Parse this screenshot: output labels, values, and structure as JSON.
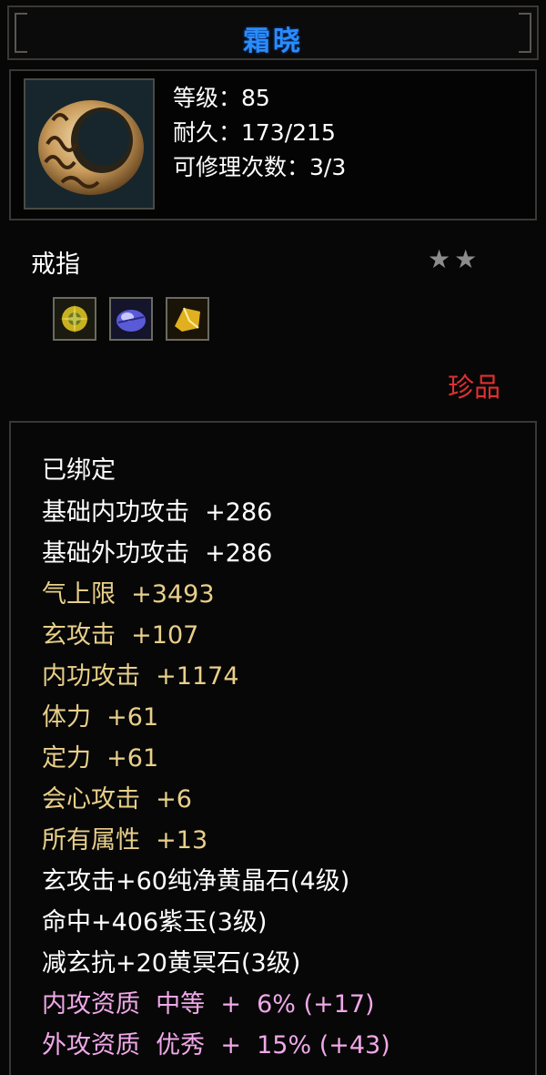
{
  "title": "霜晓",
  "item": {
    "icon": "ring-icon",
    "level": "等级：85",
    "durability": "耐久：173/215",
    "repairs": "可修理次数：3/3",
    "type": "戒指",
    "stars": 2,
    "rarity": "珍品",
    "rarity_color": "#e03030",
    "gems": [
      "yellow-crystal-gem-icon",
      "purple-jade-gem-icon",
      "yellow-stone-gem-icon"
    ]
  },
  "attributes": [
    {
      "text": "已绑定",
      "color": "white"
    },
    {
      "text": "基础内功攻击  +286",
      "color": "white"
    },
    {
      "text": "基础外功攻击  +286",
      "color": "white"
    },
    {
      "text": "气上限  +3493",
      "color": "gold"
    },
    {
      "text": "玄攻击  +107",
      "color": "gold"
    },
    {
      "text": "内功攻击  +1174",
      "color": "gold"
    },
    {
      "text": "体力  +61",
      "color": "gold"
    },
    {
      "text": "定力  +61",
      "color": "gold"
    },
    {
      "text": "会心攻击  +6",
      "color": "gold"
    },
    {
      "text": "所有属性  +13",
      "color": "gold"
    },
    {
      "text": "玄攻击+60纯净黄晶石(4级)",
      "color": "white"
    },
    {
      "text": "命中+406紫玉(3级)",
      "color": "white"
    },
    {
      "text": "减玄抗+20黄冥石(3级)",
      "color": "white"
    },
    {
      "text": "内攻资质  中等  +  6% (+17)",
      "color": "pink"
    },
    {
      "text": "外攻资质  优秀  +  15% (+43)",
      "color": "pink"
    }
  ]
}
